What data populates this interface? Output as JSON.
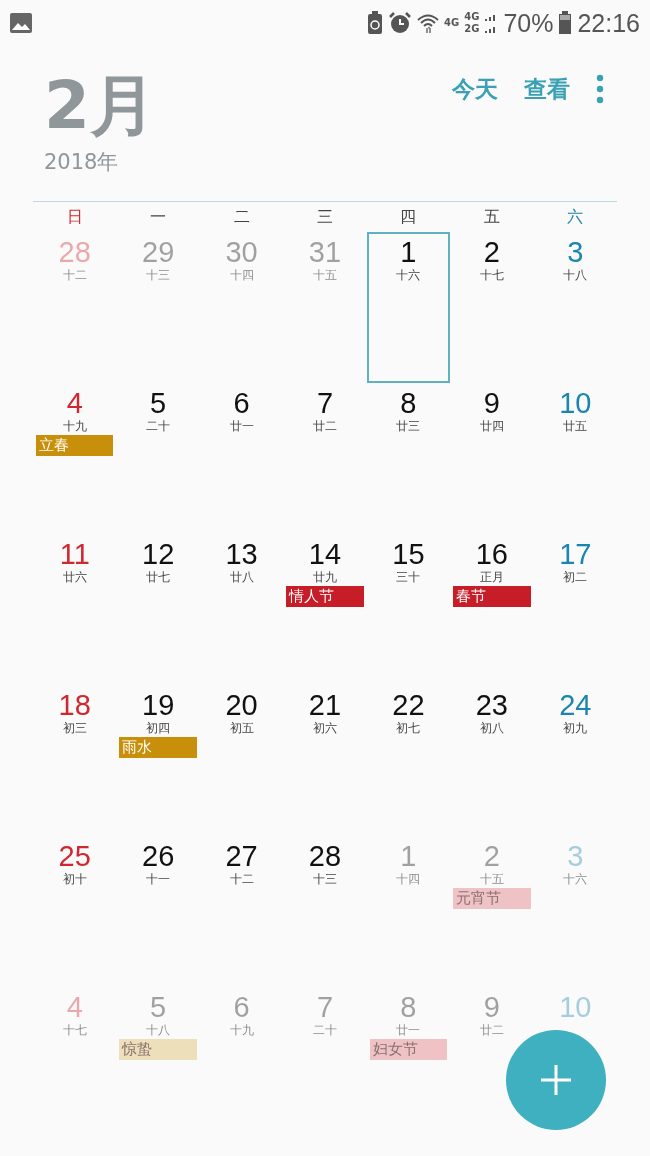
{
  "status_bar": {
    "network_labels": [
      "4G",
      "4G",
      "2G"
    ],
    "battery_text": "70%",
    "time": "22:16"
  },
  "header": {
    "month": "2月",
    "year": "2018年",
    "actions": [
      "今天",
      "查看"
    ]
  },
  "weekdays": [
    "日",
    "一",
    "二",
    "三",
    "四",
    "五",
    "六"
  ],
  "weeks": [
    [
      {
        "day": "28",
        "lunar": "十二",
        "in_month": false,
        "selected": false
      },
      {
        "day": "29",
        "lunar": "十三",
        "in_month": false,
        "selected": false
      },
      {
        "day": "30",
        "lunar": "十四",
        "in_month": false,
        "selected": false
      },
      {
        "day": "31",
        "lunar": "十五",
        "in_month": false,
        "selected": false
      },
      {
        "day": "1",
        "lunar": "十六",
        "in_month": true,
        "selected": true
      },
      {
        "day": "2",
        "lunar": "十七",
        "in_month": true,
        "selected": false
      },
      {
        "day": "3",
        "lunar": "十八",
        "in_month": true,
        "selected": false
      }
    ],
    [
      {
        "day": "4",
        "lunar": "十九",
        "in_month": true,
        "selected": false,
        "event": {
          "label": "立春",
          "color": "#c8900a"
        }
      },
      {
        "day": "5",
        "lunar": "二十",
        "in_month": true,
        "selected": false
      },
      {
        "day": "6",
        "lunar": "廿一",
        "in_month": true,
        "selected": false
      },
      {
        "day": "7",
        "lunar": "廿二",
        "in_month": true,
        "selected": false
      },
      {
        "day": "8",
        "lunar": "廿三",
        "in_month": true,
        "selected": false
      },
      {
        "day": "9",
        "lunar": "廿四",
        "in_month": true,
        "selected": false
      },
      {
        "day": "10",
        "lunar": "廿五",
        "in_month": true,
        "selected": false
      }
    ],
    [
      {
        "day": "11",
        "lunar": "廿六",
        "in_month": true,
        "selected": false
      },
      {
        "day": "12",
        "lunar": "廿七",
        "in_month": true,
        "selected": false
      },
      {
        "day": "13",
        "lunar": "廿八",
        "in_month": true,
        "selected": false
      },
      {
        "day": "14",
        "lunar": "廿九",
        "in_month": true,
        "selected": false,
        "event": {
          "label": "情人节",
          "color": "#c61d28"
        }
      },
      {
        "day": "15",
        "lunar": "三十",
        "in_month": true,
        "selected": false
      },
      {
        "day": "16",
        "lunar": "正月",
        "in_month": true,
        "selected": false,
        "event": {
          "label": "春节",
          "color": "#c61d28"
        }
      },
      {
        "day": "17",
        "lunar": "初二",
        "in_month": true,
        "selected": false
      }
    ],
    [
      {
        "day": "18",
        "lunar": "初三",
        "in_month": true,
        "selected": false
      },
      {
        "day": "19",
        "lunar": "初四",
        "in_month": true,
        "selected": false,
        "event": {
          "label": "雨水",
          "color": "#c8900a"
        }
      },
      {
        "day": "20",
        "lunar": "初五",
        "in_month": true,
        "selected": false
      },
      {
        "day": "21",
        "lunar": "初六",
        "in_month": true,
        "selected": false
      },
      {
        "day": "22",
        "lunar": "初七",
        "in_month": true,
        "selected": false
      },
      {
        "day": "23",
        "lunar": "初八",
        "in_month": true,
        "selected": false
      },
      {
        "day": "24",
        "lunar": "初九",
        "in_month": true,
        "selected": false
      }
    ],
    [
      {
        "day": "25",
        "lunar": "初十",
        "in_month": true,
        "selected": false
      },
      {
        "day": "26",
        "lunar": "十一",
        "in_month": true,
        "selected": false
      },
      {
        "day": "27",
        "lunar": "十二",
        "in_month": true,
        "selected": false
      },
      {
        "day": "28",
        "lunar": "十三",
        "in_month": true,
        "selected": false
      },
      {
        "day": "1",
        "lunar": "十四",
        "in_month": false,
        "selected": false
      },
      {
        "day": "2",
        "lunar": "十五",
        "in_month": false,
        "selected": false,
        "event": {
          "label": "元宵节",
          "color": "#efc3c6"
        }
      },
      {
        "day": "3",
        "lunar": "十六",
        "in_month": false,
        "selected": false
      }
    ],
    [
      {
        "day": "4",
        "lunar": "十七",
        "in_month": false,
        "selected": false
      },
      {
        "day": "5",
        "lunar": "十八",
        "in_month": false,
        "selected": false,
        "event": {
          "label": "惊蛰",
          "color": "#eedfbb"
        }
      },
      {
        "day": "6",
        "lunar": "十九",
        "in_month": false,
        "selected": false
      },
      {
        "day": "7",
        "lunar": "二十",
        "in_month": false,
        "selected": false
      },
      {
        "day": "8",
        "lunar": "廿一",
        "in_month": false,
        "selected": false,
        "event": {
          "label": "妇女节",
          "color": "#efc3c6"
        }
      },
      {
        "day": "9",
        "lunar": "廿二",
        "in_month": false,
        "selected": false
      },
      {
        "day": "10",
        "in_month": false,
        "selected": false
      }
    ]
  ]
}
